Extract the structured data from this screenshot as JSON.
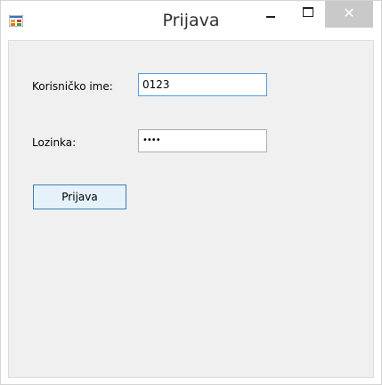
{
  "window": {
    "title": "Prijava",
    "minimize_glyph": "",
    "maximize_glyph": "",
    "close_glyph": "✕"
  },
  "form": {
    "username_label": "Korisničko ime:",
    "username_value": "0123",
    "password_label": "Lozinka:",
    "password_value": "••••",
    "login_button": "Prijava"
  },
  "colors": {
    "client_background": "#f0f0f0",
    "focused_border": "#569de5",
    "button_background": "#e5f1fb",
    "button_border": "#3c7fb1",
    "close_button": "#c9c9c9"
  },
  "icons": {
    "app": "windows-form-icon",
    "minimize": "minimize-icon",
    "maximize": "maximize-icon",
    "close": "close-icon"
  }
}
